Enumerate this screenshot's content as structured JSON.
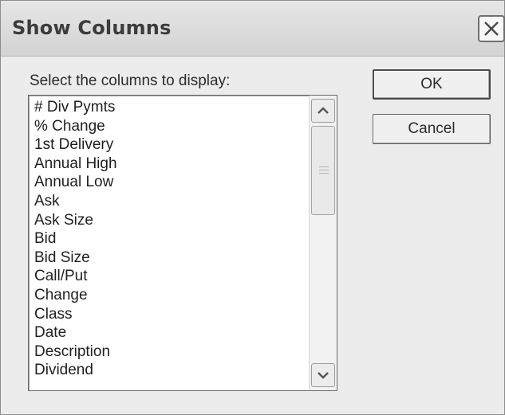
{
  "dialog": {
    "title": "Show Columns",
    "prompt": "Select the columns to display:",
    "ok_label": "OK",
    "cancel_label": "Cancel"
  },
  "columns": [
    "# Div Pymts",
    "% Change",
    "1st Delivery",
    "Annual High",
    "Annual Low",
    "Ask",
    "Ask Size",
    "Bid",
    "Bid Size",
    "Call/Put",
    "Change",
    "Class",
    "Date",
    "Description",
    "Dividend"
  ]
}
